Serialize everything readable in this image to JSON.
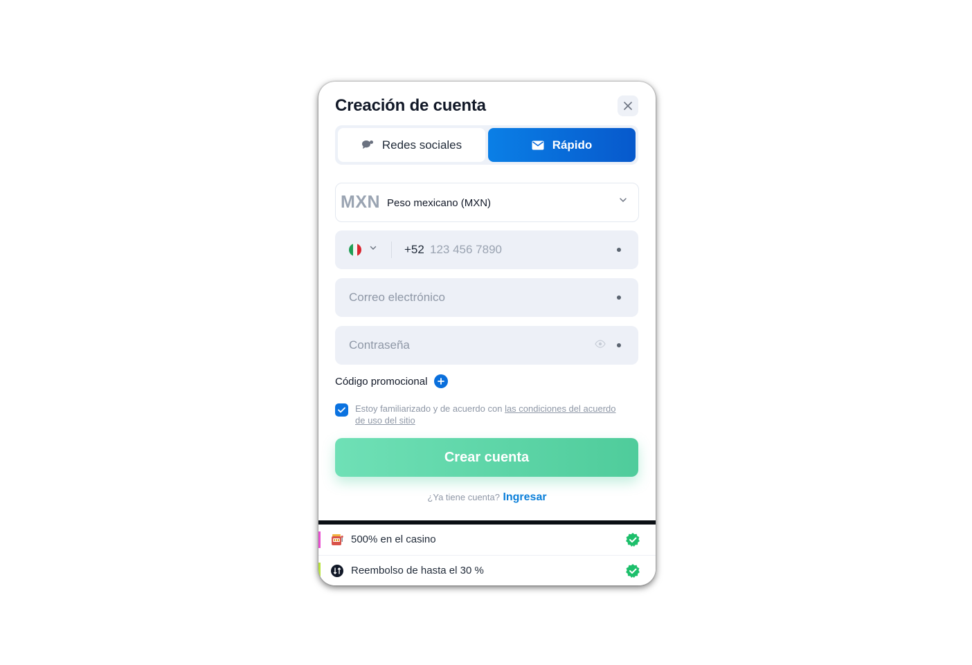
{
  "modal": {
    "title": "Creación de cuenta",
    "tabs": [
      {
        "label": "Redes sociales",
        "active": false
      },
      {
        "label": "Rápido",
        "active": true
      }
    ],
    "currency": {
      "code": "MXN",
      "name": "Peso mexicano (MXN)"
    },
    "phone": {
      "country_code": "+52",
      "placeholder": "123 456 7890",
      "country": "MX"
    },
    "email": {
      "placeholder": "Correo electrónico"
    },
    "password": {
      "placeholder": "Contraseña"
    },
    "promo": {
      "label": "Código promocional"
    },
    "terms": {
      "checked": true,
      "text": "Estoy familiarizado y de acuerdo con ",
      "link": "las condiciones del acuerdo de uso del sitio"
    },
    "create_button": "Crear cuenta",
    "login": {
      "question": "¿Ya tiene cuenta?",
      "link": "Ingresar"
    },
    "bonuses": [
      {
        "text": "500% en el casino",
        "icon": "slot-machine-icon",
        "accent": "#e94fd1"
      },
      {
        "text": "Reembolso de hasta el 30 %",
        "icon": "cashback-icon",
        "accent": "#b7e23a"
      }
    ]
  },
  "colors": {
    "primary_blue": "#0a72e0",
    "success_green": "#4fcc9b",
    "badge_green": "#1dbf6b"
  }
}
